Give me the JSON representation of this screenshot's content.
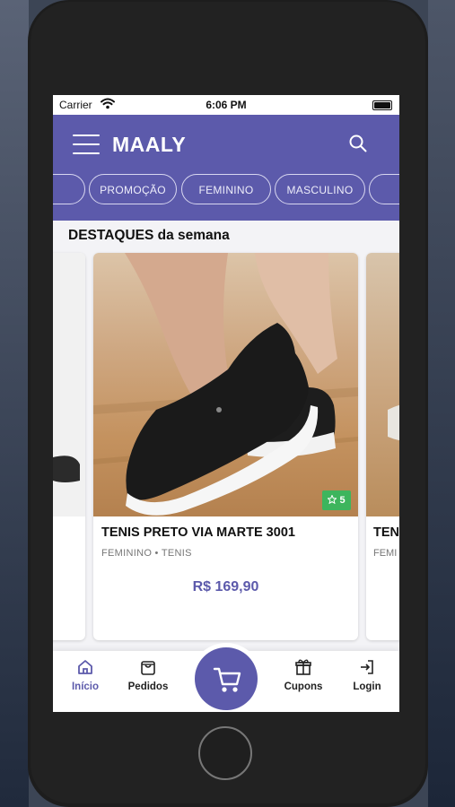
{
  "status_bar": {
    "carrier": "Carrier",
    "time": "6:06 PM"
  },
  "header": {
    "brand": "MAALY"
  },
  "categories": [
    "PROMOÇÃO",
    "FEMININO",
    "MASCULINO"
  ],
  "section": {
    "title": "DESTAQUES da semana"
  },
  "featured_product": {
    "name": "TENIS PRETO VIA MARTE 3001",
    "category": "FEMININO • TENIS",
    "price": "R$ 169,90",
    "rating": "5"
  },
  "next_product": {
    "name_visible": "TEN",
    "category_visible": "FEMI"
  },
  "tabs": {
    "home": "Início",
    "orders": "Pedidos",
    "coupons": "Cupons",
    "login": "Login"
  },
  "colors": {
    "brand": "#5c5aab",
    "rating_badge": "#3db55d"
  },
  "icons": [
    "menu-icon",
    "search-icon",
    "star-icon",
    "home-icon",
    "bag-icon",
    "cart-icon",
    "gift-icon",
    "login-icon"
  ]
}
